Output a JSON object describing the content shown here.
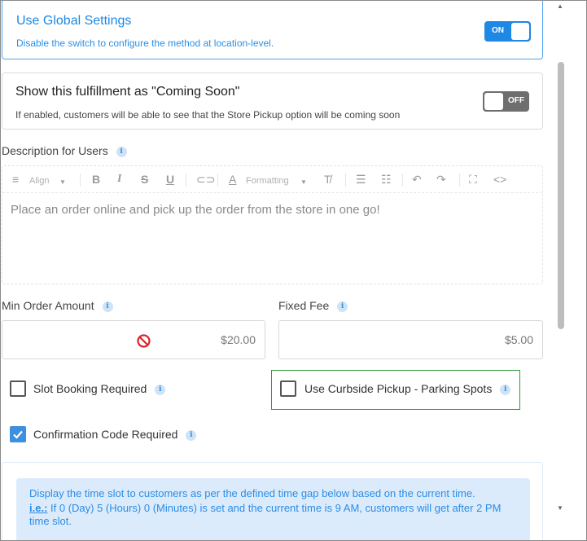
{
  "global_settings": {
    "title": "Use Global Settings",
    "subtitle": "Disable the switch to configure the method at location-level.",
    "toggle_label": "ON",
    "toggle_state": "on"
  },
  "coming_soon": {
    "title": "Show this fulfillment as \"Coming Soon\"",
    "subtitle": "If enabled, customers will be able to see that the Store Pickup option will be coming soon",
    "toggle_label": "OFF",
    "toggle_state": "off"
  },
  "description": {
    "label": "Description for Users",
    "toolbar": {
      "align": "Align",
      "formatting": "Formatting"
    },
    "content": "Place an order online and pick up the order from the store in one go!"
  },
  "min_order": {
    "label": "Min Order Amount",
    "value": "$20.00"
  },
  "fixed_fee": {
    "label": "Fixed Fee",
    "value": "$5.00"
  },
  "checkboxes": {
    "slot_booking": {
      "label": "Slot Booking Required",
      "checked": false
    },
    "curbside": {
      "label": "Use Curbside Pickup - Parking Spots",
      "checked": false
    },
    "confirmation": {
      "label": "Confirmation Code Required",
      "checked": true
    }
  },
  "notice": {
    "line1": "Display the time slot to customers as per the defined time gap below based on the current time.",
    "ie": "i.e.:",
    "line2": " If 0 (Day) 5 (Hours) 0 (Minutes) is set and the current time is 9 AM, customers will get after 2 PM time slot."
  },
  "colors": {
    "accent": "#1e88e5",
    "highlight_border": "#2f9a3a",
    "no_entry": "#d9252b"
  }
}
